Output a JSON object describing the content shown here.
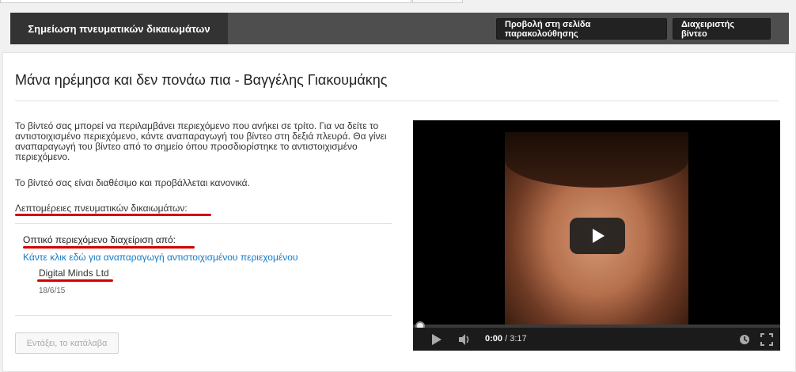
{
  "header": {
    "tab_label": "Σημείωση πνευματικών δικαιωμάτων",
    "watch_page_button": "Προβολή στη σελίδα παρακολούθησης",
    "video_manager_button": "Διαχειριστής βίντεο"
  },
  "main": {
    "title": "Μάνα ηρέμησα και δεν πονάω πια - Βαγγέλης Γιακουμάκης",
    "description": "Το βίντεό σας μπορεί να περιλαμβάνει περιεχόμενο που ανήκει σε τρίτο. Για να δείτε το αντιστοιχισμένο περιεχόμενο, κάντε αναπαραγωγή του βίντεο στη δεξιά πλευρά. Θα γίνει αναπαραγωγή του βίντεο από το σημείο όπου προσδιορίστηκε το αντιστοιχισμένο περιεχόμενο.",
    "status": "Το βίντεό σας είναι διαθέσιμο και προβάλλεται κανονικά.",
    "details_label": "Λεπτομέρειες πνευματικών δικαιωμάτων:",
    "claim": {
      "managed_by_label": "Οπτικό περιεχόμενο διαχείριση από:",
      "play_link": "Κάντε κλικ εδώ για αναπαραγωγή αντιστοιχισμένου περιεχομένου",
      "owner": "Digital Minds Ltd",
      "date": "18/6/15"
    },
    "acknowledge_button": "Εντάξει, το κατάλαβα"
  },
  "player": {
    "current_time": "0:00",
    "duration": "/ 3:17",
    "progress": 0
  },
  "icons": {
    "play": "play-icon",
    "volume": "volume-icon",
    "clock": "clock-icon",
    "fullscreen": "fullscreen-icon"
  },
  "colors": {
    "link": "#167ac6",
    "highlight": "#d40000",
    "header_bg": "#4e4e4e"
  }
}
